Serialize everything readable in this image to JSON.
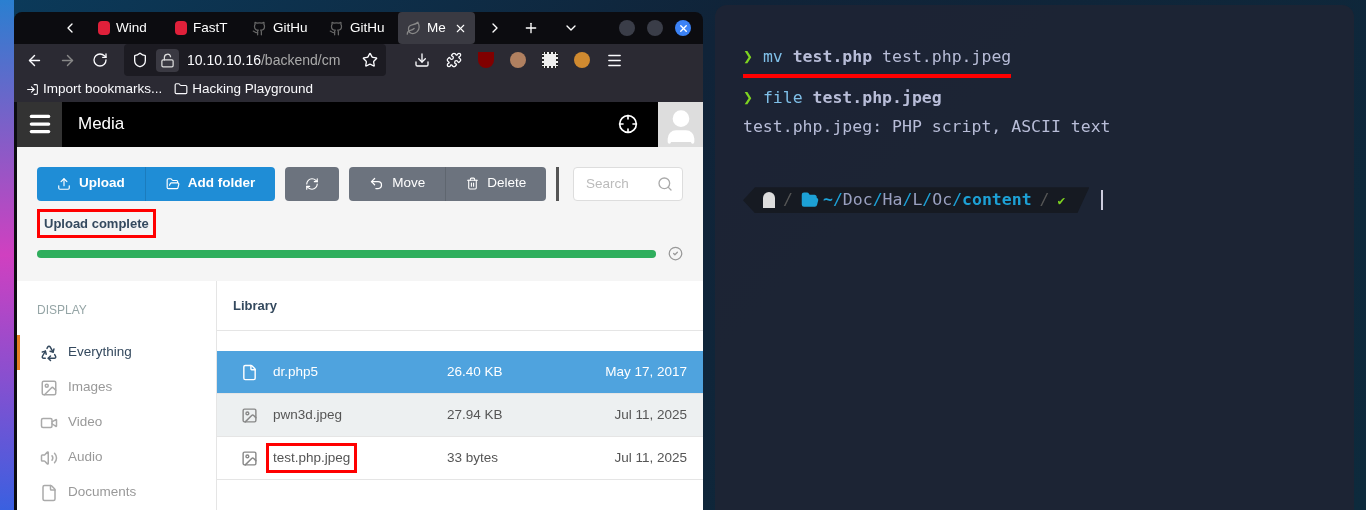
{
  "browser": {
    "tabs": [
      {
        "label": "Wind",
        "selected": false,
        "kind": "red"
      },
      {
        "label": "FastT",
        "selected": false,
        "kind": "red"
      },
      {
        "label": "GitHu",
        "selected": false,
        "kind": "github"
      },
      {
        "label": "GitHu",
        "selected": false,
        "kind": "github"
      },
      {
        "label": "Me",
        "selected": true,
        "kind": "leaf"
      }
    ],
    "url": {
      "host": "10.10.10.16",
      "path": "/backend/cm"
    },
    "bookmarks": [
      {
        "label": "Import bookmarks...",
        "kind": "import"
      },
      {
        "label": "Hacking Playground",
        "kind": "folder"
      }
    ]
  },
  "app": {
    "title": "Media",
    "toolbar": [
      {
        "label": "Upload",
        "kind": "upload"
      },
      {
        "label": "Add folder",
        "kind": "folder"
      },
      {
        "kind": "refresh"
      },
      {
        "label": "Move",
        "kind": "move"
      },
      {
        "label": "Delete",
        "kind": "delete"
      }
    ],
    "search": {
      "placeholder": "Search"
    },
    "upload": {
      "status": "Upload complete",
      "level": 1,
      "annotated": true
    },
    "sidebar": {
      "heading": "DISPLAY",
      "items": [
        {
          "label": "Everything",
          "kind": "everything",
          "selected": true
        },
        {
          "label": "Images",
          "kind": "images",
          "selected": false
        },
        {
          "label": "Video",
          "kind": "video",
          "selected": false
        },
        {
          "label": "Audio",
          "kind": "audio",
          "selected": false
        },
        {
          "label": "Documents",
          "kind": "documents",
          "selected": false
        }
      ]
    },
    "library": {
      "title": "Library",
      "rows": [
        {
          "name": "dr.php5",
          "size": "26.40 KB",
          "date": "May 17, 2017",
          "kind": "file",
          "selected": true,
          "annotated": false
        },
        {
          "name": "pwn3d.jpeg",
          "size": "27.94 KB",
          "date": "Jul 11, 2025",
          "kind": "image",
          "selected": false,
          "annotated": false
        },
        {
          "name": "test.php.jpeg",
          "size": "33 bytes",
          "date": "Jul 11, 2025",
          "kind": "image",
          "selected": false,
          "annotated": true
        }
      ]
    }
  },
  "terminal": {
    "prompt_symbol": "❯",
    "lines": [
      {
        "kind": "command",
        "command": "mv",
        "args": [
          {
            "text": "test.php",
            "bold": true
          },
          {
            "text": "test.php.jpeg",
            "bold": false
          }
        ],
        "annotated": true
      },
      {
        "kind": "command",
        "command": "file",
        "args": [
          {
            "text": "test.php.jpeg",
            "bold": true
          }
        ],
        "annotated": false
      },
      {
        "kind": "output",
        "text": "test.php.jpeg: PHP script, ASCII text"
      }
    ],
    "prompt": {
      "dividers": [
        "/",
        "/"
      ],
      "path": [
        {
          "text": "~",
          "kind": "home"
        },
        {
          "text": "/",
          "kind": "sep"
        },
        {
          "text": "Doc",
          "kind": "dir"
        },
        {
          "text": "/",
          "kind": "sep"
        },
        {
          "text": "Ha",
          "kind": "dir"
        },
        {
          "text": "/",
          "kind": "sep"
        },
        {
          "text": "L",
          "kind": "dir"
        },
        {
          "text": "/",
          "kind": "sep"
        },
        {
          "text": "Oc",
          "kind": "dir"
        },
        {
          "text": "/",
          "kind": "sep"
        },
        {
          "text": "content",
          "kind": "current"
        }
      ],
      "status": "✔"
    }
  }
}
